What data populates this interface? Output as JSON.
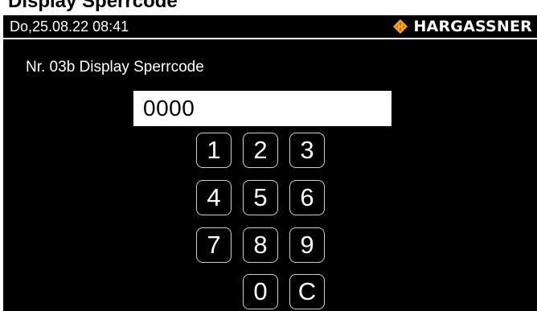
{
  "page_header": {
    "text": "Display Sperrcode"
  },
  "status_bar": {
    "datetime": "Do,25.08.22 08:41",
    "brand": "HARGASSNER",
    "logo_icon": "hargassner-diamond-logo-icon",
    "accent_color": "#f5a623"
  },
  "screen": {
    "title": "Nr. 03b Display Sperrcode"
  },
  "code_field": {
    "value": "0000"
  },
  "keypad": {
    "keys": [
      "1",
      "2",
      "3",
      "4",
      "5",
      "6",
      "7",
      "8",
      "9",
      "0",
      "C"
    ]
  },
  "colors": {
    "background": "#000000",
    "foreground": "#ffffff",
    "key_border": "#cfcfcf"
  }
}
